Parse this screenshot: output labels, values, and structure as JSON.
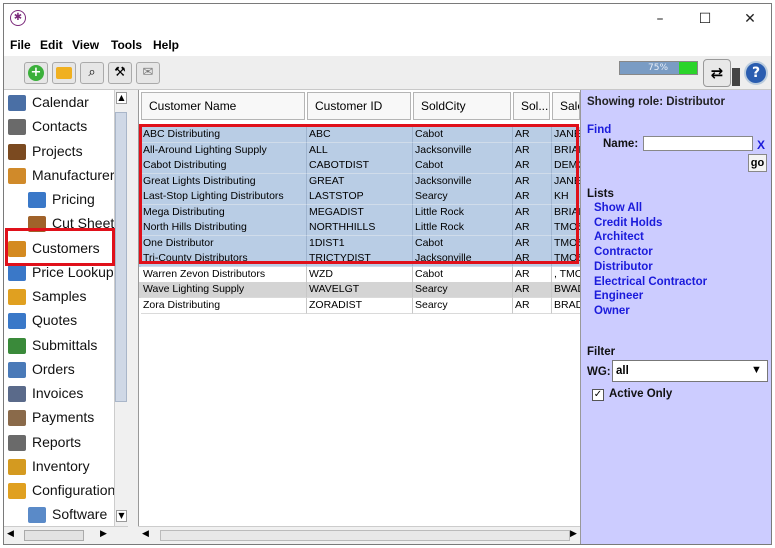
{
  "window": {
    "app_icon": "app-logo-icon",
    "minimize": "–",
    "maximize": "☐",
    "close": "✕"
  },
  "menubar": {
    "items": [
      "File",
      "Edit",
      "View",
      "Tools",
      "Help"
    ]
  },
  "toolbar": {
    "buttons": [
      "add-icon",
      "folder-icon",
      "binoculars-icon",
      "tools-icon",
      "email-icon"
    ],
    "progress_text": "75%",
    "progress_value": 75
  },
  "sidebar": {
    "items": [
      {
        "label": "Calendar",
        "icon": "calendar-icon",
        "color": "#4a6fa5"
      },
      {
        "label": "Contacts",
        "icon": "contacts-icon",
        "color": "#6a6a6a"
      },
      {
        "label": "Projects",
        "icon": "projects-icon",
        "color": "#7b4a20"
      },
      {
        "label": "Manufacturers",
        "icon": "manufacturers-icon",
        "color": "#d08a2a"
      },
      {
        "label": "Pricing",
        "icon": "pricing-icon",
        "color": "#3a78c8",
        "sub": true
      },
      {
        "label": "Cut Sheets",
        "icon": "cut-sheet-icon",
        "color": "#a0622a",
        "sub": true
      },
      {
        "label": "Customers",
        "icon": "customers-icon",
        "color": "#d48a20"
      },
      {
        "label": "Price Lookup",
        "icon": "price-lookup-icon",
        "color": "#3a78c8"
      },
      {
        "label": "Samples",
        "icon": "samples-icon",
        "color": "#e0a020"
      },
      {
        "label": "Quotes",
        "icon": "quotes-icon",
        "color": "#3a78c8"
      },
      {
        "label": "Submittals",
        "icon": "submittals-icon",
        "color": "#3a8a3a"
      },
      {
        "label": "Orders",
        "icon": "orders-icon",
        "color": "#4a7ab8"
      },
      {
        "label": "Invoices",
        "icon": "invoices-icon",
        "color": "#5a6a8a"
      },
      {
        "label": "Payments",
        "icon": "payments-icon",
        "color": "#8a6a4a"
      },
      {
        "label": "Reports",
        "icon": "reports-icon",
        "color": "#6a6a6a"
      },
      {
        "label": "Inventory",
        "icon": "inventory-icon",
        "color": "#d49a20"
      },
      {
        "label": "Configuration",
        "icon": "configuration-icon",
        "color": "#e0a020"
      },
      {
        "label": "Software",
        "icon": "software-icon",
        "color": "#5a8ac8",
        "sub": true
      }
    ]
  },
  "table": {
    "columns": [
      "Customer Name",
      "Customer ID",
      "SoldCity",
      "Sol...",
      "Sale"
    ],
    "rows": [
      [
        "ABC Distributing",
        "ABC",
        "Cabot",
        "AR",
        "JANE"
      ],
      [
        "All-Around Lighting Supply",
        "ALL",
        "Jacksonville",
        "AR",
        "BRIAN"
      ],
      [
        "Cabot Distributing",
        "CABOTDIST",
        "Cabot",
        "AR",
        "DEMO"
      ],
      [
        "Great Lights Distributing",
        "GREAT",
        "Jacksonville",
        "AR",
        "JANE"
      ],
      [
        "Last-Stop Lighting Distributors",
        "LASTSTOP",
        "Searcy",
        "AR",
        "KH"
      ],
      [
        "Mega Distributing",
        "MEGADIST",
        "Little Rock",
        "AR",
        "BRIAN"
      ],
      [
        "North Hills Distributing",
        "NORTHHILLS",
        "Little Rock",
        "AR",
        "TMOS"
      ],
      [
        "One Distributor",
        "1DIST1",
        "Cabot",
        "AR",
        "TMOS"
      ],
      [
        "Tri-County Distributors",
        "TRICTYDIST",
        "Jacksonville",
        "AR",
        "TMOS"
      ],
      [
        "Warren Zevon Distributors",
        "WZD",
        "Cabot",
        "AR",
        ", TMC"
      ],
      [
        "Wave Lighting Supply",
        "WAVELGT",
        "Searcy",
        "AR",
        "BWAD"
      ],
      [
        "Zora Distributing",
        "ZORADIST",
        "Searcy",
        "AR",
        "BRAD"
      ]
    ]
  },
  "right_panel": {
    "role_text": "Showing role: Distributor",
    "find_label": "Find",
    "name_label": "Name:",
    "name_value": "",
    "clear_label": "X",
    "go_label": "go",
    "lists_label": "Lists",
    "lists": [
      "Show All",
      "Credit Holds",
      "Architect",
      "Contractor",
      "Distributor",
      "Electrical Contractor",
      "Engineer",
      "Owner"
    ],
    "filter_label": "Filter",
    "wg_label": "WG:",
    "wg_value": "all",
    "active_only_label": "Active Only",
    "active_only_checked": true
  },
  "colors": {
    "accent_highlight": "#e0101a",
    "selection": "#b9cde5",
    "panel": "#ccccff",
    "link": "#1a1adb"
  }
}
